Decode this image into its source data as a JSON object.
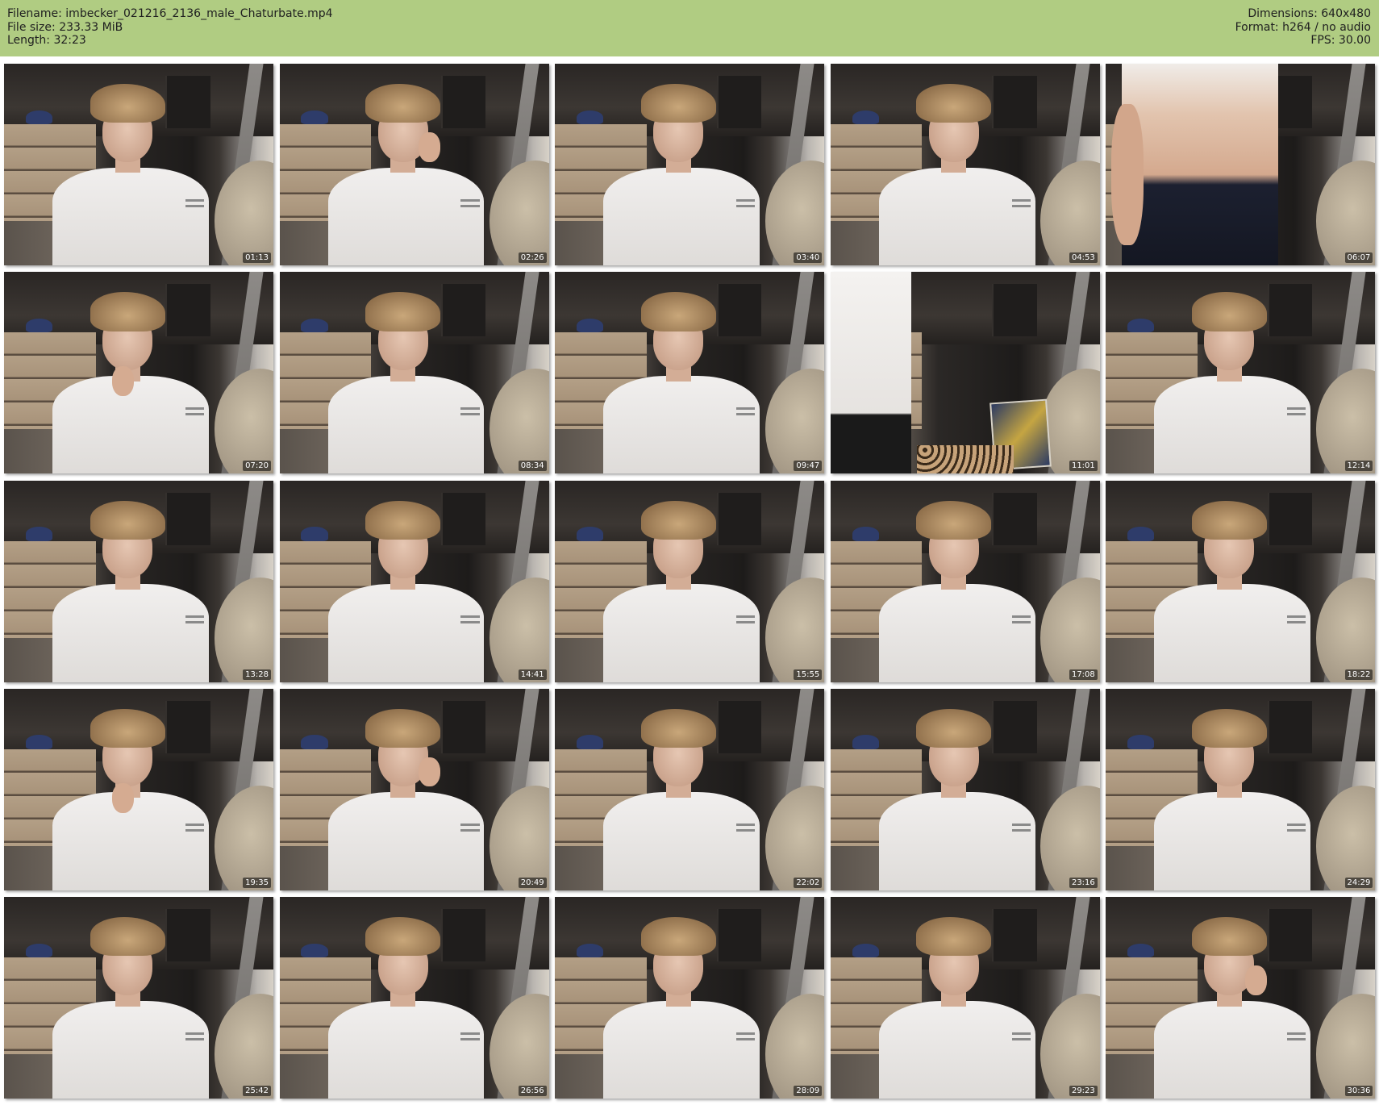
{
  "header": {
    "filename_line": "Filename: imbecker_021216_2136_male_Chaturbate.mp4",
    "filesize_line": "File size: 233.33 MiB",
    "length_line": "Length: 32:23",
    "dimensions_line": "Dimensions: 640x480",
    "format_line": "Format: h264 / no audio",
    "fps_line": "FPS: 30.00",
    "background_color": "#b0cc82"
  },
  "thumbnails": [
    {
      "timestamp": "01:13",
      "variant": "default"
    },
    {
      "timestamp": "02:26",
      "variant": "hand-cheek"
    },
    {
      "timestamp": "03:40",
      "variant": "default"
    },
    {
      "timestamp": "04:53",
      "variant": "default"
    },
    {
      "timestamp": "06:07",
      "variant": "torso"
    },
    {
      "timestamp": "07:20",
      "variant": "hand-chin"
    },
    {
      "timestamp": "08:34",
      "variant": "default"
    },
    {
      "timestamp": "09:47",
      "variant": "default"
    },
    {
      "timestamp": "11:01",
      "variant": "standing"
    },
    {
      "timestamp": "12:14",
      "variant": "default"
    },
    {
      "timestamp": "13:28",
      "variant": "default"
    },
    {
      "timestamp": "14:41",
      "variant": "default"
    },
    {
      "timestamp": "15:55",
      "variant": "default"
    },
    {
      "timestamp": "17:08",
      "variant": "default"
    },
    {
      "timestamp": "18:22",
      "variant": "default"
    },
    {
      "timestamp": "19:35",
      "variant": "hand-chin"
    },
    {
      "timestamp": "20:49",
      "variant": "hand-cheek"
    },
    {
      "timestamp": "22:02",
      "variant": "default"
    },
    {
      "timestamp": "23:16",
      "variant": "default"
    },
    {
      "timestamp": "24:29",
      "variant": "default"
    },
    {
      "timestamp": "25:42",
      "variant": "default"
    },
    {
      "timestamp": "26:56",
      "variant": "default"
    },
    {
      "timestamp": "28:09",
      "variant": "default"
    },
    {
      "timestamp": "29:23",
      "variant": "default"
    },
    {
      "timestamp": "30:36",
      "variant": "hand-cheek"
    }
  ]
}
